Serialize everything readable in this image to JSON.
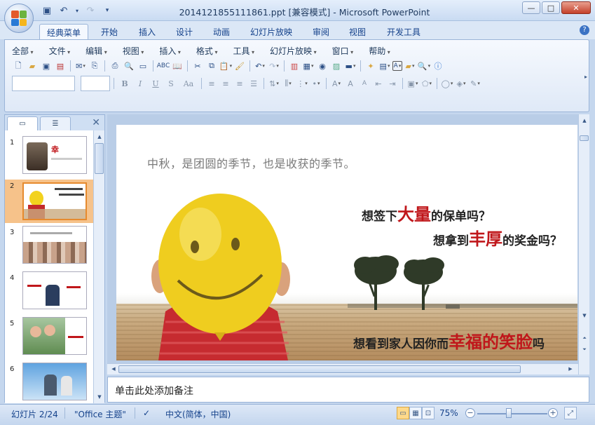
{
  "window": {
    "title": "2014121855111861.ppt [兼容模式] - Microsoft PowerPoint",
    "minimize": "—",
    "maximize": "□",
    "close": "✕"
  },
  "ribbon_tabs": [
    "经典菜单",
    "开始",
    "插入",
    "设计",
    "动画",
    "幻灯片放映",
    "审阅",
    "视图",
    "开发工具"
  ],
  "active_tab": "经典菜单",
  "menus": [
    "全部",
    "文件",
    "编辑",
    "视图",
    "插入",
    "格式",
    "工具",
    "幻灯片放映",
    "窗口",
    "帮助"
  ],
  "format_buttons": {
    "bold": "B",
    "italic": "I",
    "underline": "U",
    "strike": "S",
    "case": "Aa"
  },
  "slides_panel": {
    "slide_numbers": [
      "1",
      "2",
      "3",
      "4",
      "5",
      "6"
    ],
    "selected": "2"
  },
  "slide": {
    "subtitle": "中秋，是团圆的季节，也是收获的季节。",
    "q1": {
      "pre": "想签下",
      "big": "大量",
      "post": "的保单吗？"
    },
    "q2": {
      "pre": "想拿到",
      "big": "丰厚",
      "post": "的奖金吗？"
    },
    "q3": {
      "pre": "想看到家人因你而",
      "big": "幸福的笑脸",
      "post": "吗"
    }
  },
  "notes": {
    "placeholder": "单击此处添加备注"
  },
  "status_bar": {
    "slide_info": "幻灯片 2/24",
    "theme": "\"Office 主题\"",
    "language": "中文(简体，中国)",
    "zoom": "75%",
    "zoom_level": 0.45
  },
  "colors": {
    "accent_red": "#c0171b",
    "balloon": "#f2d21e",
    "selection": "#f6c28a"
  }
}
